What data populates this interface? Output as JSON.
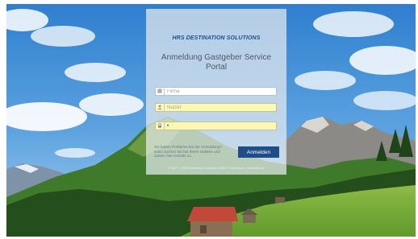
{
  "brand": "HRS DESTINATION SOLUTIONS",
  "title": "Anmeldung Gastgeber Service Portal",
  "form": {
    "company_placeholder": "Firma",
    "company_value": "",
    "user_placeholder": "Nutzer",
    "user_value": "",
    "password_value": "•",
    "login_label": "Anmelden"
  },
  "help_text": "Sie haben Probleme bei der Anmeldung? Dann suchen Sie bei Ihrem Gebiete und nutzen hier Kontakt zu",
  "footer": "© 2017 - HRS Destination Solutions GmbH • Impressum • Datenschutz",
  "icons": {
    "company": "building-icon",
    "user": "user-icon",
    "password": "lock-icon"
  },
  "colors": {
    "brand": "#1f4f8f",
    "button": "#1f4d87",
    "highlight_field": "#fbf7b5"
  }
}
